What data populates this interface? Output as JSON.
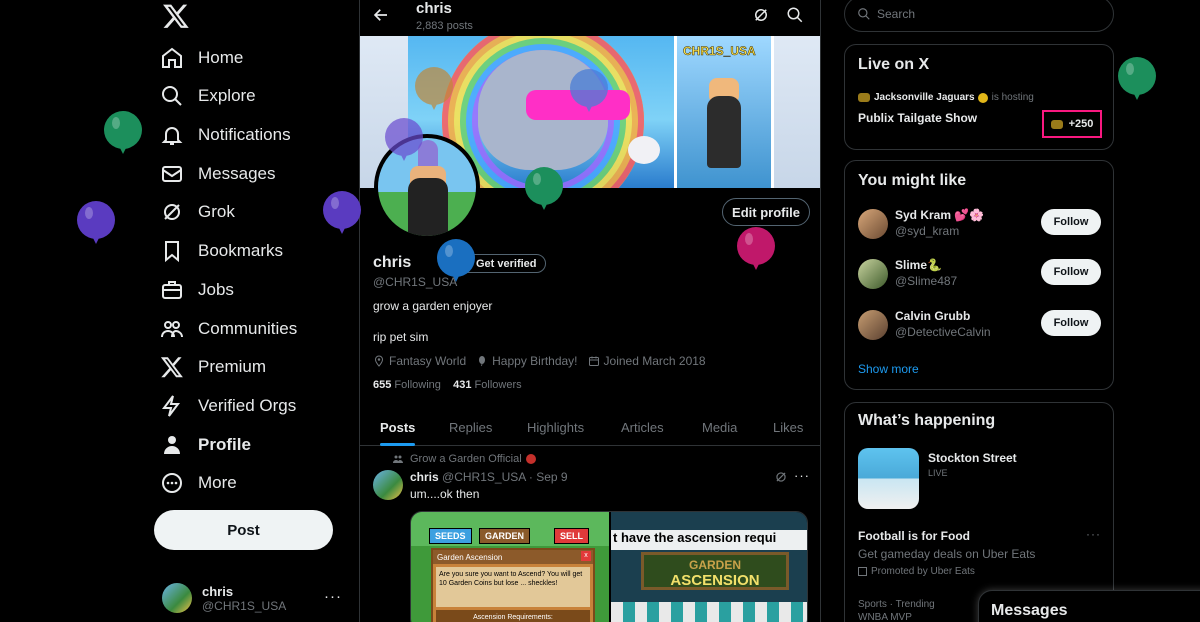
{
  "nav": {
    "items": [
      {
        "label": "Home",
        "icon": "home-icon"
      },
      {
        "label": "Explore",
        "icon": "search-icon"
      },
      {
        "label": "Notifications",
        "icon": "bell-icon"
      },
      {
        "label": "Messages",
        "icon": "mail-icon"
      },
      {
        "label": "Grok",
        "icon": "grok-icon"
      },
      {
        "label": "Bookmarks",
        "icon": "bookmark-icon"
      },
      {
        "label": "Jobs",
        "icon": "briefcase-icon"
      },
      {
        "label": "Communities",
        "icon": "communities-icon"
      },
      {
        "label": "Premium",
        "icon": "x-logo-icon"
      },
      {
        "label": "Verified Orgs",
        "icon": "lightning-icon"
      },
      {
        "label": "Profile",
        "icon": "person-icon"
      },
      {
        "label": "More",
        "icon": "more-circle-icon"
      }
    ],
    "post_label": "Post",
    "account": {
      "name": "chris",
      "handle": "@CHR1S_USA"
    }
  },
  "header": {
    "title": "chris",
    "post_count": "2,883 posts"
  },
  "banner": {
    "text": "CHR1S_USA"
  },
  "profile": {
    "name": "chris",
    "verify_label": "Get verified",
    "handle": "@CHR1S_USA",
    "bio_line1": "grow a garden enjoyer",
    "bio_line2": "rip pet sim",
    "location": "Fantasy World",
    "birthday": "Happy Birthday!",
    "joined": "Joined March 2018",
    "following_count": "655",
    "following_label": "Following",
    "followers_count": "431",
    "followers_label": "Followers",
    "edit_label": "Edit profile"
  },
  "tabs": [
    "Posts",
    "Replies",
    "Highlights",
    "Articles",
    "Media",
    "Likes"
  ],
  "tweet": {
    "context": "Grow a Garden Official",
    "name": "chris",
    "handle_time": "@CHR1S_USA · Sep 9",
    "text": "um....ok then",
    "media_left": {
      "chips": [
        "SEEDS",
        "GARDEN",
        "SELL"
      ],
      "dialog_title": "Garden Ascension",
      "dialog_body": "Are you sure you want to Ascend? You will get 10 Garden Coins but lose ... sheckles!",
      "requirements": "Ascension Requirements:"
    },
    "media_right": {
      "caption": "t have the ascension requi",
      "sign_top": "GARDEN",
      "sign_bottom": "ASCENSION"
    }
  },
  "search": {
    "placeholder": "Search"
  },
  "live": {
    "title": "Live on X",
    "host": "Jacksonville Jaguars",
    "hosting": "is hosting",
    "show": "Publix Tailgate Show",
    "count": "+250"
  },
  "suggest": {
    "title": "You might like",
    "users": [
      {
        "name": "Syd Kram 💕🌸",
        "handle": "@syd_kram",
        "follow": "Follow"
      },
      {
        "name": "Slime🐍",
        "handle": "@Slime487",
        "follow": "Follow"
      },
      {
        "name": "Calvin Grubb",
        "handle": "@DetectiveCalvin",
        "follow": "Follow"
      }
    ],
    "show_more": "Show more"
  },
  "happening": {
    "title": "What’s happening",
    "trend1_title": "Stockton Street",
    "trend1_status": "LIVE",
    "ad_title": "Football is for Food",
    "ad_desc": "Get gameday deals on Uber Eats",
    "ad_promoted": "Promoted by Uber Eats",
    "trend2_context": "Sports · Trending",
    "trend2_title": "WNBA MVP"
  },
  "drawer": {
    "title": "Messages"
  },
  "colors": {
    "accent": "#1d9bf0",
    "live_border": "#f91880",
    "bg": "#000000"
  }
}
